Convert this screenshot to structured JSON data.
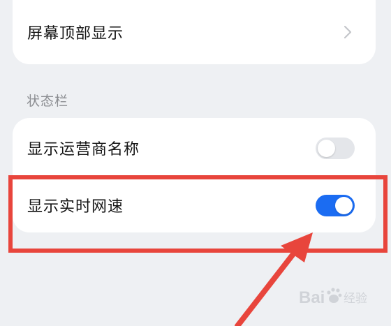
{
  "screen_top": {
    "label": "屏幕顶部显示",
    "chevron_icon": "chevron-right-icon"
  },
  "status_bar": {
    "section_title": "状态栏",
    "items": [
      {
        "label": "显示运营商名称",
        "toggle": "off"
      },
      {
        "label": "显示实时网速",
        "toggle": "on"
      }
    ]
  },
  "colors": {
    "toggle_on": "#1b6cf2",
    "toggle_off": "#e4e6ea",
    "highlight": "#e8453c"
  },
  "annotations": {
    "highlight_box": "red-rectangle",
    "arrow": "red-arrow-icon"
  },
  "watermark": {
    "text": "Baidu 经验",
    "icon": "baidu-paw-icon"
  }
}
